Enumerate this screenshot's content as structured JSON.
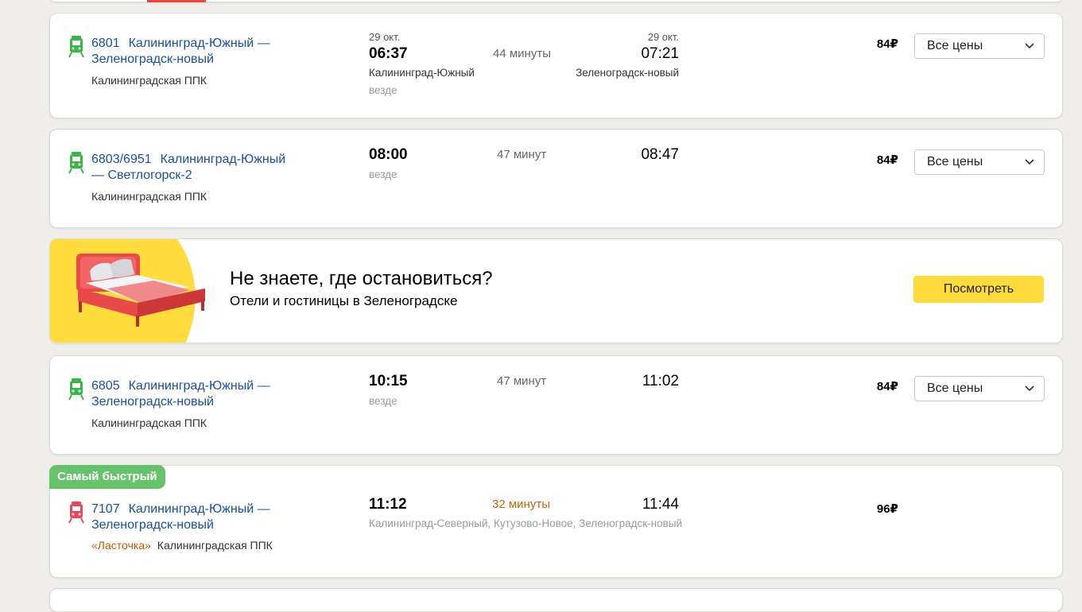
{
  "colors": {
    "background": "#efeeeb",
    "link": "#1a4fa3",
    "suburban_train_icon": "#3ab54a",
    "express_train_icon": "#e8455a",
    "fastest_badge": "#67c36b",
    "ad_button": "#ffdc3c",
    "ad_accent": "#ffdc3c"
  },
  "trips": [
    {
      "icon": "suburban-train-icon",
      "number": "6801",
      "route": "Калининград-Южный — Зеленоградск-новый",
      "brand": "",
      "carrier": "Калининградская ППК",
      "departure_date": "29 окт.",
      "departure_time": "06:37",
      "departure_station": "Калининград-Южный",
      "stops": "везде",
      "duration": "44 минуты",
      "arrival_date": "29 окт.",
      "arrival_time": "07:21",
      "arrival_station": "Зеленоградск-новый",
      "price": "84₽",
      "select_label": "Все цены"
    },
    {
      "icon": "suburban-train-icon",
      "number": "6803/6951",
      "route": "Калининград-Южный — Светлогорск-2",
      "brand": "",
      "carrier": "Калининградская ППК",
      "departure_time": "08:00",
      "stops": "везде",
      "duration": "47 минут",
      "arrival_time": "08:47",
      "price": "84₽",
      "select_label": "Все цены"
    },
    {
      "icon": "suburban-train-icon",
      "number": "6805",
      "route": "Калининград-Южный — Зеленоградск-новый",
      "brand": "",
      "carrier": "Калининградская ППК",
      "departure_time": "10:15",
      "stops": "везде",
      "duration": "47 минут",
      "arrival_time": "11:02",
      "price": "84₽",
      "select_label": "Все цены"
    },
    {
      "badge": "Самый быстрый",
      "icon": "express-train-icon",
      "number": "7107",
      "route": "Калининград-Южный — Зеленоградск-новый",
      "brand": "«Ласточка»",
      "carrier": "Калининградская ППК",
      "departure_time": "11:12",
      "stops": "Калининград-Северный, Кутузово-Новое, Зеленоградск-новый",
      "duration": "32 минуты",
      "arrival_time": "11:44",
      "price": "96₽"
    }
  ],
  "ad": {
    "title": "Не знаете, где остановиться?",
    "subtitle": "Отели и гостиницы в Зеленоградске",
    "button": "Посмотреть",
    "image": "bed-illustration"
  }
}
